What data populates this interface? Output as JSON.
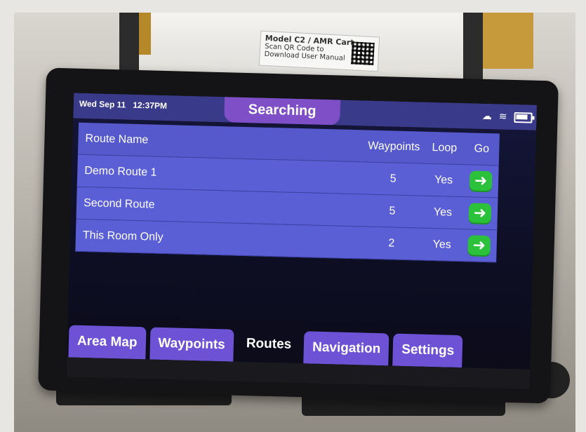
{
  "status_bar": {
    "date": "Wed Sep 11",
    "time": "12:37PM",
    "status_text": "Searching"
  },
  "table": {
    "headers": {
      "name": "Route Name",
      "waypoints": "Waypoints",
      "loop": "Loop",
      "go": "Go"
    },
    "rows": [
      {
        "name": "Demo Route 1",
        "waypoints": "5",
        "loop": "Yes"
      },
      {
        "name": "Second Route",
        "waypoints": "5",
        "loop": "Yes"
      },
      {
        "name": "This Room Only",
        "waypoints": "2",
        "loop": "Yes"
      }
    ]
  },
  "tabs": [
    {
      "label": "Area Map"
    },
    {
      "label": "Waypoints"
    },
    {
      "label": "Routes"
    },
    {
      "label": "Navigation"
    },
    {
      "label": "Settings"
    }
  ],
  "cart_label": {
    "title": "Model C2 / AMR Cart",
    "line1": "Scan QR Code to",
    "line2": "Download User Manual"
  },
  "icons": {
    "cloud": "cloud-icon",
    "wifi": "wifi-icon",
    "battery": "battery-icon",
    "go": "arrow-right-icon"
  },
  "colors": {
    "status_bar": "#3a3a8a",
    "status_pill": "#7e4fc6",
    "row": "#5b5fd6",
    "tab": "#6d52d6",
    "go_button": "#2bc13a"
  }
}
